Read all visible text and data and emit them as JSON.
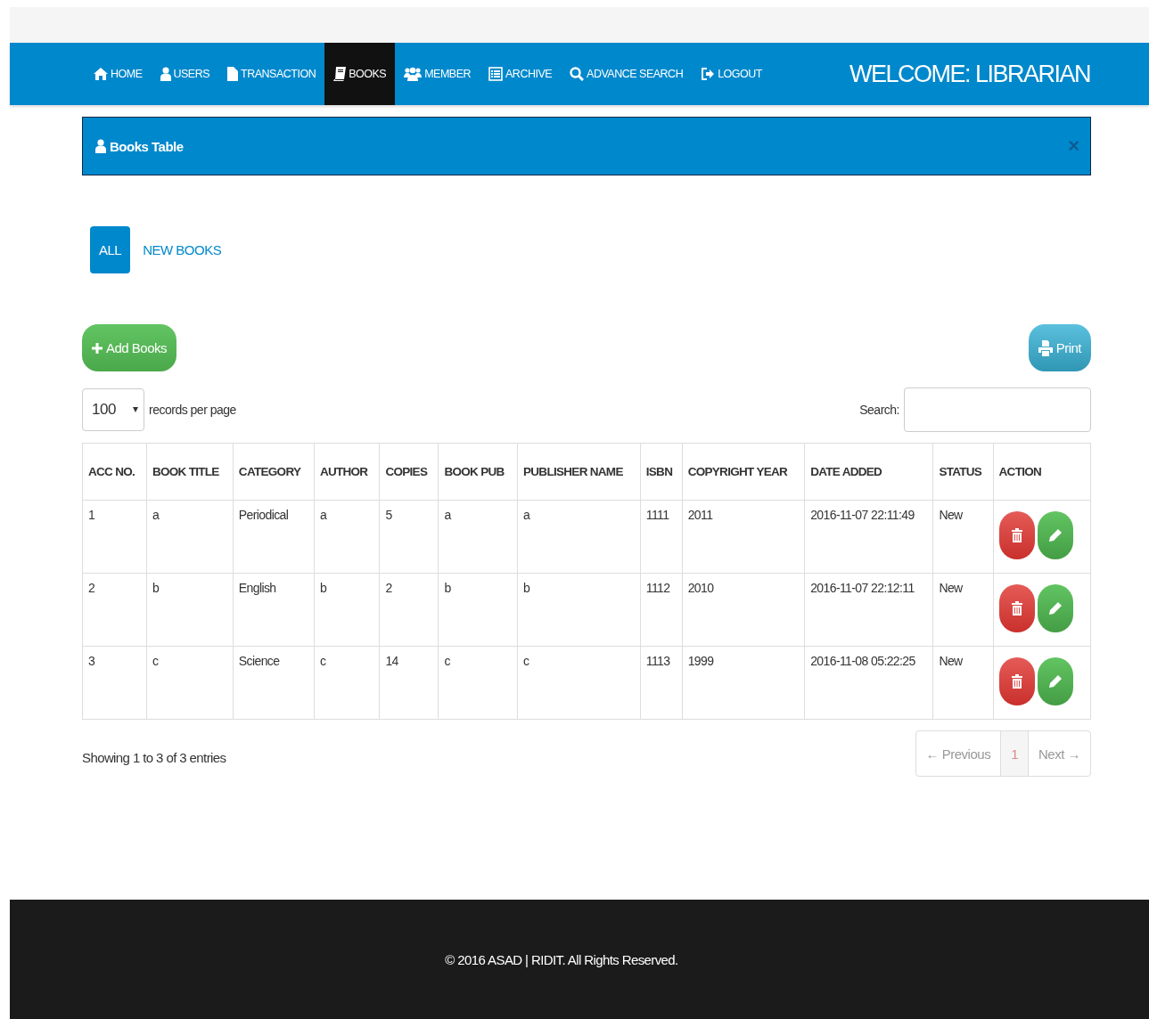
{
  "nav": {
    "items": [
      {
        "label": "HOME",
        "selected": false
      },
      {
        "label": "USERS",
        "selected": false
      },
      {
        "label": "TRANSACTION",
        "selected": false
      },
      {
        "label": "BOOKS",
        "selected": true
      },
      {
        "label": "MEMBER",
        "selected": false
      },
      {
        "label": "ARCHIVE",
        "selected": false
      },
      {
        "label": "ADVANCE SEARCH",
        "selected": false
      },
      {
        "label": "LOGOUT",
        "selected": false
      }
    ],
    "welcome": "WELCOME: LIBRARIAN"
  },
  "panel": {
    "title": "Books Table",
    "close": "×"
  },
  "tabs": [
    {
      "label": "ALL",
      "selected": true
    },
    {
      "label": "NEW BOOKS",
      "selected": false
    }
  ],
  "add_button": "Add Books",
  "print_button": "Print",
  "length": {
    "value": "100",
    "label": "records per page"
  },
  "search": {
    "label": "Search:"
  },
  "table": {
    "columns": [
      "ACC NO.",
      "BOOK TITLE",
      "CATEGORY",
      "AUTHOR",
      "COPIES",
      "BOOK PUB",
      "PUBLISHER NAME",
      "ISBN",
      "COPYRIGHT YEAR",
      "DATE ADDED",
      "STATUS",
      "ACTION"
    ],
    "rows": [
      [
        "1",
        "a",
        "Periodical",
        "a",
        "5",
        "a",
        "a",
        "1111",
        "2011",
        "2016-11-07 22:11:49",
        "New"
      ],
      [
        "2",
        "b",
        "English",
        "b",
        "2",
        "b",
        "b",
        "1112",
        "2010",
        "2016-11-07 22:12:11",
        "New"
      ],
      [
        "3",
        "c",
        "Science",
        "c",
        "14",
        "c",
        "c",
        "1113",
        "1999",
        "2016-11-08 05:22:25",
        "New"
      ]
    ]
  },
  "info": "Showing 1 to 3 of 3 entries",
  "pagination": [
    {
      "label": "← Previous",
      "selected": false
    },
    {
      "label": "1",
      "selected": true
    },
    {
      "label": "Next →",
      "selected": false
    }
  ],
  "footer": "© 2016 ASAD | RIDIT. All Rights Reserved."
}
